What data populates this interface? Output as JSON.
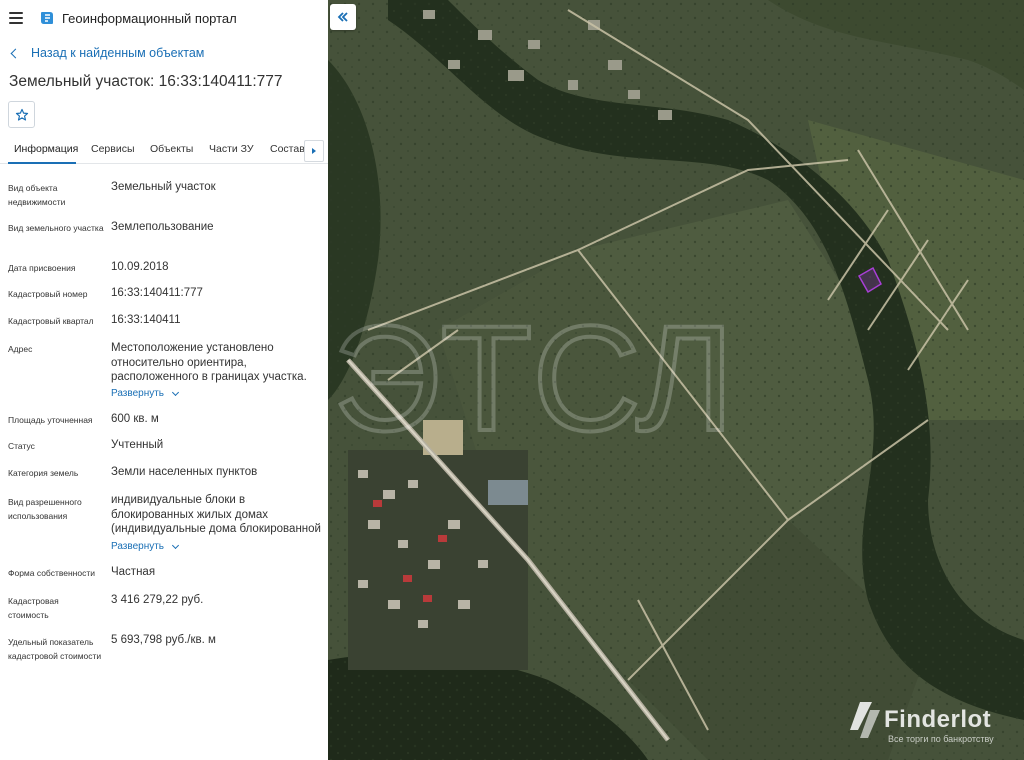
{
  "header": {
    "app_title": "Геоинформационный портал"
  },
  "nav": {
    "back_label": "Назад к найденным объектам"
  },
  "object": {
    "title": "Земельный участок: 16:33:140411:777"
  },
  "tabs": [
    {
      "label": "Информация",
      "active": true
    },
    {
      "label": "Сервисы"
    },
    {
      "label": "Объекты"
    },
    {
      "label": "Части ЗУ"
    },
    {
      "label": "Состав"
    }
  ],
  "properties": [
    {
      "label": "Вид объекта недвижимости",
      "value": "Земельный участок"
    },
    {
      "label": "Вид земельного участка",
      "value": "Землепользование"
    },
    {
      "label": "Дата присвоения",
      "value": "10.09.2018"
    },
    {
      "label": "Кадастровый номер",
      "value": "16:33:140411:777"
    },
    {
      "label": "Кадастровый квартал",
      "value": "16:33:140411"
    },
    {
      "label": "Адрес",
      "value": "Местоположение установлено относительно ориентира, расположенного в границах участка.",
      "expand": "Развернуть"
    },
    {
      "label": "Площадь уточненная",
      "value": "600 кв. м"
    },
    {
      "label": "Статус",
      "value": "Учтенный"
    },
    {
      "label": "Категория земель",
      "value": "Земли населенных пунктов"
    },
    {
      "label": "Вид разрешенного использования",
      "value": "индивидуальные блоки в блокированных жилых домах (индивидуальные дома блокированной",
      "expand": "Развернуть"
    },
    {
      "label": "Форма собственности",
      "value": "Частная"
    },
    {
      "label": "Кадастровая стоимость",
      "value": "3 416 279,22 руб."
    },
    {
      "label": "Удельный показатель кадастровой стоимости",
      "value": "5 693,798 руб./кв. м"
    }
  ],
  "map": {
    "watermark_center": "МЭТСЛ",
    "watermark_brand": "Finderlot",
    "watermark_tagline": "Все торги по банкротству",
    "parcel_color": "#a83fd6"
  },
  "colors": {
    "accent": "#1a6fb5"
  }
}
